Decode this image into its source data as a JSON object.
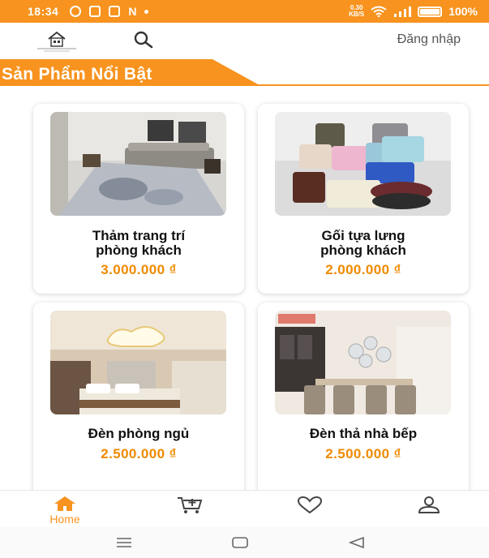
{
  "status_bar": {
    "time": "18:34",
    "net_speed_value": "0.30",
    "net_speed_unit": "KB/S",
    "battery": "100%"
  },
  "header": {
    "login_label": "Đăng nhập",
    "search_icon": "search-icon",
    "logo_icon": "house-logo-icon"
  },
  "section": {
    "title": "Sản Phẩm Nổi Bật"
  },
  "products": [
    {
      "name_line1": "Thảm trang trí",
      "name_line2": "phòng khách",
      "price": "3.000.000 ₫",
      "image": "living-room-rug-photo"
    },
    {
      "name_line1": "Gối tựa lưng",
      "name_line2": "phòng khách",
      "price": "2.000.000 ₫",
      "image": "cushions-photo"
    },
    {
      "name_line1": "Đèn phòng ngủ",
      "name_line2": "",
      "price": "2.500.000 ₫",
      "image": "bedroom-ceiling-light-photo"
    },
    {
      "name_line1": "Đèn thả nhà bếp",
      "name_line2": "",
      "price": "2.500.000 ₫",
      "image": "kitchen-pendant-light-photo"
    }
  ],
  "bottom_nav": {
    "items": [
      {
        "label": "Home",
        "icon": "home-icon",
        "active": true
      },
      {
        "label": "",
        "icon": "cart-add-icon"
      },
      {
        "label": "",
        "icon": "heart-icon"
      },
      {
        "label": "",
        "icon": "user-icon"
      }
    ]
  },
  "colors": {
    "accent": "#f7931e",
    "price": "#f08a00"
  }
}
